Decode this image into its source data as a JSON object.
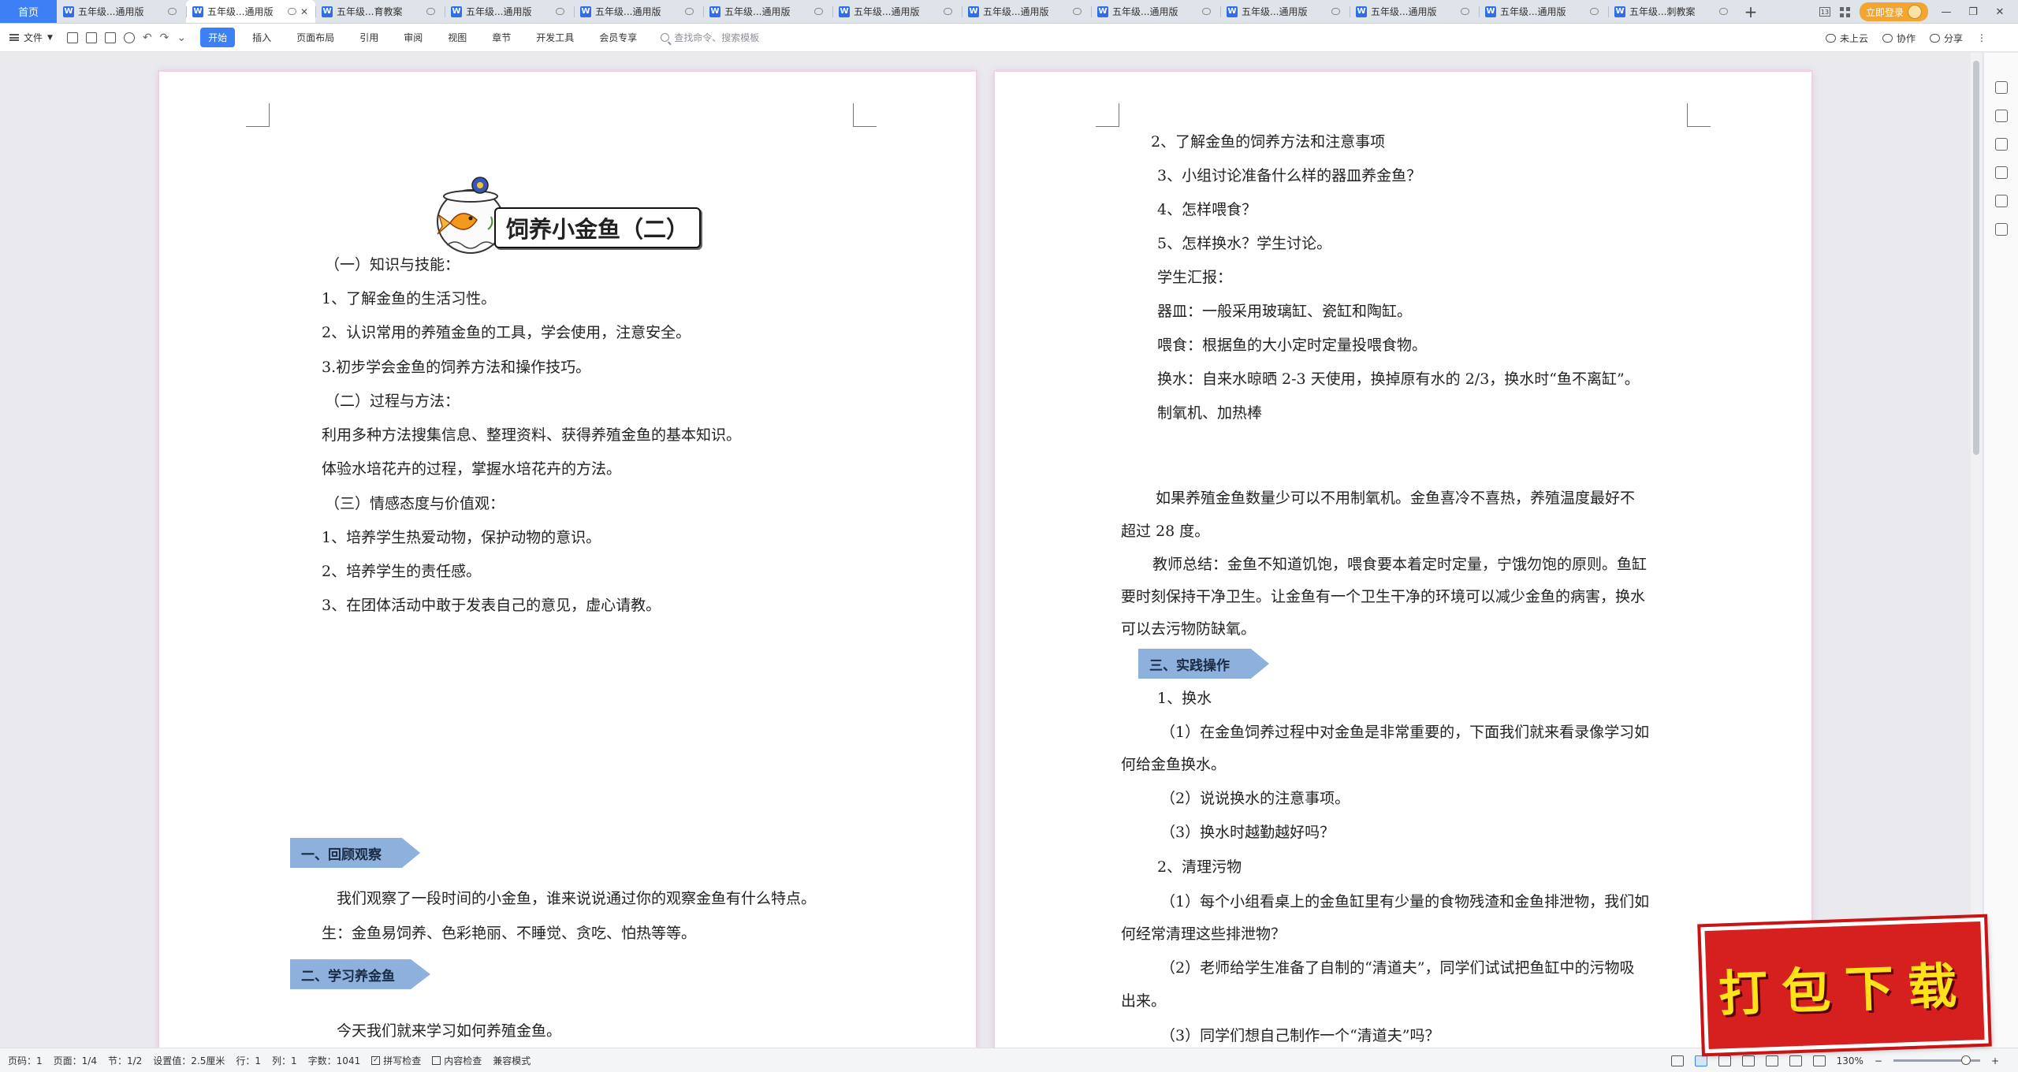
{
  "tabs": {
    "home": "首页",
    "docs": [
      {
        "title": "五年级...通用版",
        "active": false
      },
      {
        "title": "五年级...通用版",
        "active": true
      },
      {
        "title": "五年级...育教案",
        "active": false
      },
      {
        "title": "五年级...通用版",
        "active": false
      },
      {
        "title": "五年级...通用版",
        "active": false
      },
      {
        "title": "五年级...通用版",
        "active": false
      },
      {
        "title": "五年级...通用版",
        "active": false
      },
      {
        "title": "五年级...通用版",
        "active": false
      },
      {
        "title": "五年级...通用版",
        "active": false
      },
      {
        "title": "五年级...通用版",
        "active": false
      },
      {
        "title": "五年级...通用版",
        "active": false
      },
      {
        "title": "五年级...通用版",
        "active": false
      },
      {
        "title": "五年级...刺教案",
        "active": false
      }
    ],
    "new_tab": "+",
    "login": "立即登录",
    "badge": "13"
  },
  "ribbon": {
    "file": "文件",
    "tabs": [
      "开始",
      "插入",
      "页面布局",
      "引用",
      "审阅",
      "视图",
      "章节",
      "开发工具",
      "会员专享"
    ],
    "search_placeholder": "查找命令、搜索模板",
    "cloud": "未上云",
    "collab": "协作",
    "share": "分享"
  },
  "left_page": {
    "title": "饲养小金鱼（二）",
    "lines": [
      "（一）知识与技能：",
      "1、了解金鱼的生活习性。",
      "2、认识常用的养殖金鱼的工具，学会使用，注意安全。",
      "3.初步学会金鱼的饲养方法和操作技巧。",
      "（二）过程与方法：",
      "利用多种方法搜集信息、整理资料、获得养殖金鱼的基本知识。",
      "体验水培花卉的过程，掌握水培花卉的方法。",
      "（三）情感态度与价值观：",
      "1、培养学生热爱动物，保护动物的意识。",
      "2、培养学生的责任感。",
      "3、在团体活动中敢于发表自己的意见，虚心请教。"
    ],
    "banner1": "一、回顾观察",
    "review_lines": [
      "我们观察了一段时间的小金鱼，谁来说说通过你的观察金鱼有什么特点。",
      "生：金鱼易饲养、色彩艳丽、不睡觉、贪吃、怕热等等。"
    ],
    "banner2": "二、学习养金鱼",
    "learn_line": "今天我们就来学习如何养殖金鱼。"
  },
  "right_page": {
    "lines_top": [
      "2、了解金鱼的饲养方法和注意事项",
      "3、小组讨论准备什么样的器皿养金鱼？",
      "4、怎样喂食？",
      "5、怎样换水？学生讨论。",
      "学生汇报：",
      "器皿：一般采用玻璃缸、瓷缸和陶缸。",
      "喂食：根据鱼的大小定时定量投喂食物。",
      "换水：自来水晾晒 2-3 天使用，换掉原有水的 2/3，换水时“鱼不离缸”。",
      "制氧机、加热棒"
    ],
    "para1_a": "如果养殖金鱼数量少可以不用制氧机。金鱼喜冷不喜热，养殖温度最好不",
    "para1_b": "超过 28 度。",
    "para2_a": "教师总结：金鱼不知道饥饱，喂食要本着定时定量，宁饿勿饱的原则。鱼缸",
    "para2_b": "要时刻保持干净卫生。让金鱼有一个卫生干净的环境可以减少金鱼的病害，换水",
    "para2_c": "可以去污物防缺氧。",
    "banner3": "三、实践操作",
    "practice_1": "1、换水",
    "p1_a": "（1）在金鱼饲养过程中对金鱼是非常重要的，下面我们就来看录像学习如",
    "p1_b": "何给金鱼换水。",
    "p2": "（2）说说换水的注意事项。",
    "p3": "（3）换水时越勤越好吗？",
    "practice_2": "2、清理污物",
    "q1_a": "（1）每个小组看桌上的金鱼缸里有少量的食物残渣和金鱼排泄物，我们如",
    "q1_b": "何经常清理这些排泄物？",
    "q2_a": "（2）老师给学生准备了自制的“清道夫”，同学们试试把鱼缸中的污物吸",
    "q2_b": "出来。",
    "q3": "（3）同学们想自己制作一个“清道夫”吗？"
  },
  "statusbar": {
    "page_code": "页码：1",
    "pages": "页面：1/4",
    "section": "节：1/2",
    "setting": "设置值：2.5厘米",
    "row": "行：1",
    "col": "列：1",
    "words": "字数：1041",
    "spell": "拼写检查",
    "content_check": "内容检查",
    "compat": "兼容模式",
    "zoom": "130%"
  },
  "promo": "打包下载"
}
